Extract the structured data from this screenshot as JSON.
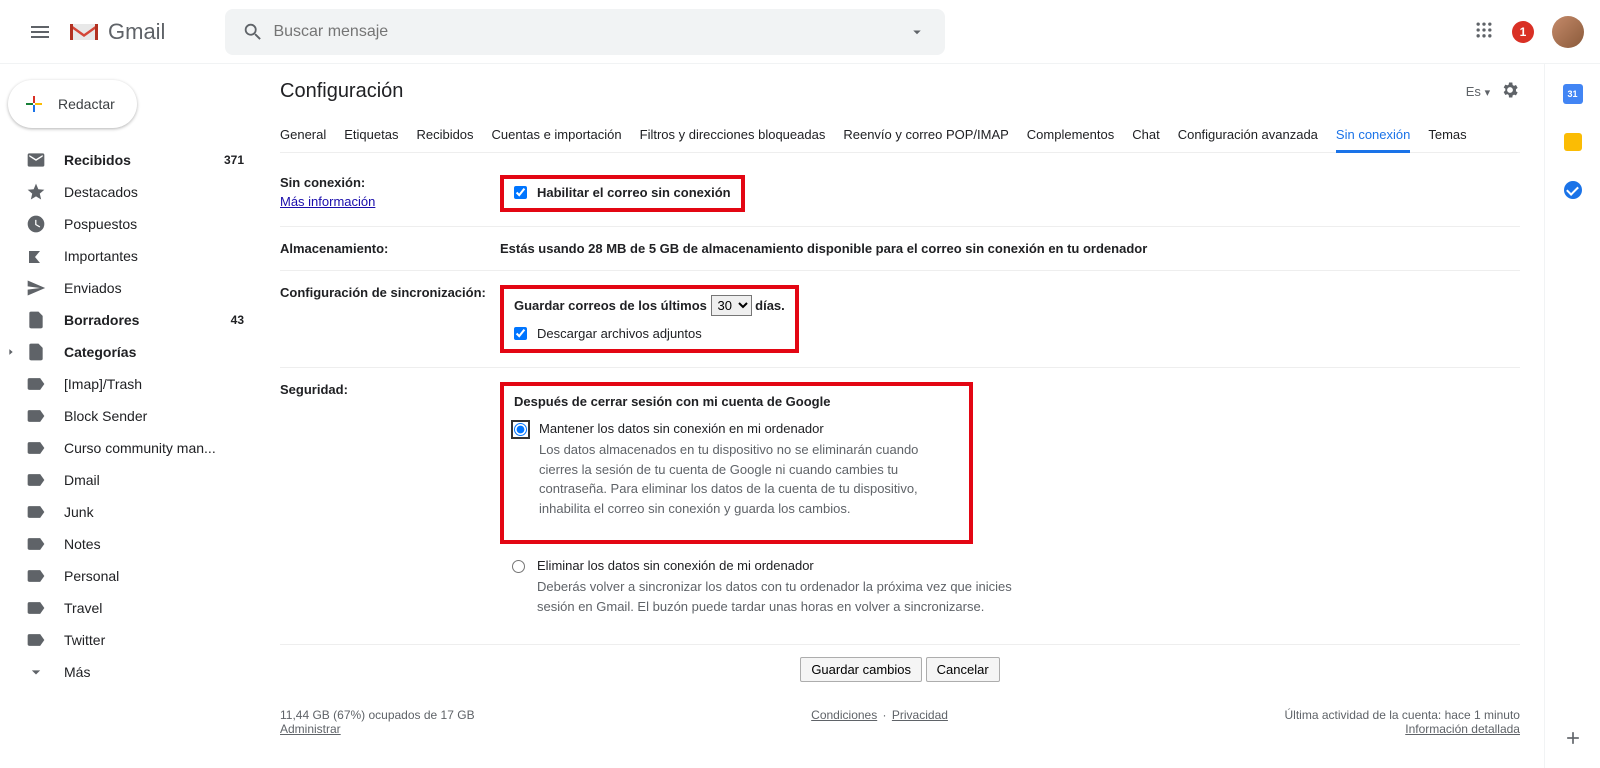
{
  "header": {
    "logo_text": "Gmail",
    "search_placeholder": "Buscar mensaje",
    "notif_count": "1"
  },
  "compose_label": "Redactar",
  "nav": [
    {
      "label": "Recibidos",
      "count": "371",
      "bold": true
    },
    {
      "label": "Destacados",
      "count": "",
      "bold": false
    },
    {
      "label": "Pospuestos",
      "count": "",
      "bold": false
    },
    {
      "label": "Importantes",
      "count": "",
      "bold": false
    },
    {
      "label": "Enviados",
      "count": "",
      "bold": false
    },
    {
      "label": "Borradores",
      "count": "43",
      "bold": true
    },
    {
      "label": "Categorías",
      "count": "",
      "bold": true
    },
    {
      "label": "[Imap]/Trash",
      "count": "",
      "bold": false
    },
    {
      "label": "Block Sender",
      "count": "",
      "bold": false
    },
    {
      "label": "Curso community man...",
      "count": "",
      "bold": false
    },
    {
      "label": "Dmail",
      "count": "",
      "bold": false
    },
    {
      "label": "Junk",
      "count": "",
      "bold": false
    },
    {
      "label": "Notes",
      "count": "",
      "bold": false
    },
    {
      "label": "Personal",
      "count": "",
      "bold": false
    },
    {
      "label": "Travel",
      "count": "",
      "bold": false
    },
    {
      "label": "Twitter",
      "count": "",
      "bold": false
    },
    {
      "label": "Más",
      "count": "",
      "bold": false
    }
  ],
  "page_title": "Configuración",
  "lang_label": "Es",
  "tabs": [
    "General",
    "Etiquetas",
    "Recibidos",
    "Cuentas e importación",
    "Filtros y direcciones bloqueadas",
    "Reenvío y correo POP/IMAP",
    "Complementos",
    "Chat",
    "Configuración avanzada",
    "Sin conexión",
    "Temas"
  ],
  "active_tab_index": 9,
  "offline": {
    "section_label": "Sin conexión:",
    "more_info": "Más información",
    "enable_label": "Habilitar el correo sin conexión"
  },
  "storage": {
    "section_label": "Almacenamiento:",
    "text": "Estás usando 28 MB de 5 GB de almacenamiento disponible para el correo sin conexión en tu ordenador"
  },
  "sync": {
    "section_label": "Configuración de sincronización:",
    "prefix": "Guardar correos de los últimos",
    "days_value": "30",
    "suffix": "días.",
    "download_label": "Descargar archivos adjuntos"
  },
  "security": {
    "section_label": "Seguridad:",
    "heading": "Después de cerrar sesión con mi cuenta de Google",
    "opt1_title": "Mantener los datos sin conexión en mi ordenador",
    "opt1_desc": "Los datos almacenados en tu dispositivo no se eliminarán cuando cierres la sesión de tu cuenta de Google ni cuando cambies tu contraseña. Para eliminar los datos de la cuenta de tu dispositivo, inhabilita el correo sin conexión y guarda los cambios.",
    "opt2_title": "Eliminar los datos sin conexión de mi ordenador",
    "opt2_desc": "Deberás volver a sincronizar los datos con tu ordenador la próxima vez que inicies sesión en Gmail. El buzón puede tardar unas horas en volver a sincronizarse."
  },
  "actions": {
    "save": "Guardar cambios",
    "cancel": "Cancelar"
  },
  "footer": {
    "quota": "11,44 GB (67%) ocupados de 17 GB",
    "manage": "Administrar",
    "terms": "Condiciones",
    "privacy": "Privacidad",
    "activity": "Última actividad de la cuenta: hace 1 minuto",
    "details": "Información detallada"
  },
  "rightbar_cal": "31"
}
